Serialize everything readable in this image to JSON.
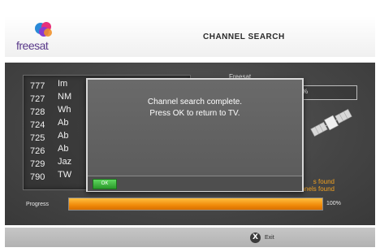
{
  "header": {
    "logo_text": "freesat",
    "title": "CHANNEL SEARCH"
  },
  "channel_list": [
    {
      "number": "777",
      "name": "Im"
    },
    {
      "number": "727",
      "name": "NM"
    },
    {
      "number": "728",
      "name": "Wh"
    },
    {
      "number": "724",
      "name": "Ab"
    },
    {
      "number": "725",
      "name": "Ab"
    },
    {
      "number": "726",
      "name": "Ab"
    },
    {
      "number": "729",
      "name": "Jaz"
    },
    {
      "number": "790",
      "name": "TW"
    }
  ],
  "info_panel": {
    "label": "Freesat",
    "box_value": "%",
    "satellite_icon": "satellite-icon"
  },
  "found_status": {
    "line1": "s found",
    "line2": "9999 name channels found"
  },
  "progress": {
    "label": "Progress",
    "percent_text": "100%",
    "value": 1.0,
    "color": "#f08a0a"
  },
  "dialog": {
    "line1": "Channel search complete.",
    "line2": "Press OK to return to TV.",
    "ok_label": "OK",
    "ok_color": "#2a9a2a"
  },
  "footer": {
    "exit_icon_glyph": "X",
    "exit_label": "Exit"
  }
}
